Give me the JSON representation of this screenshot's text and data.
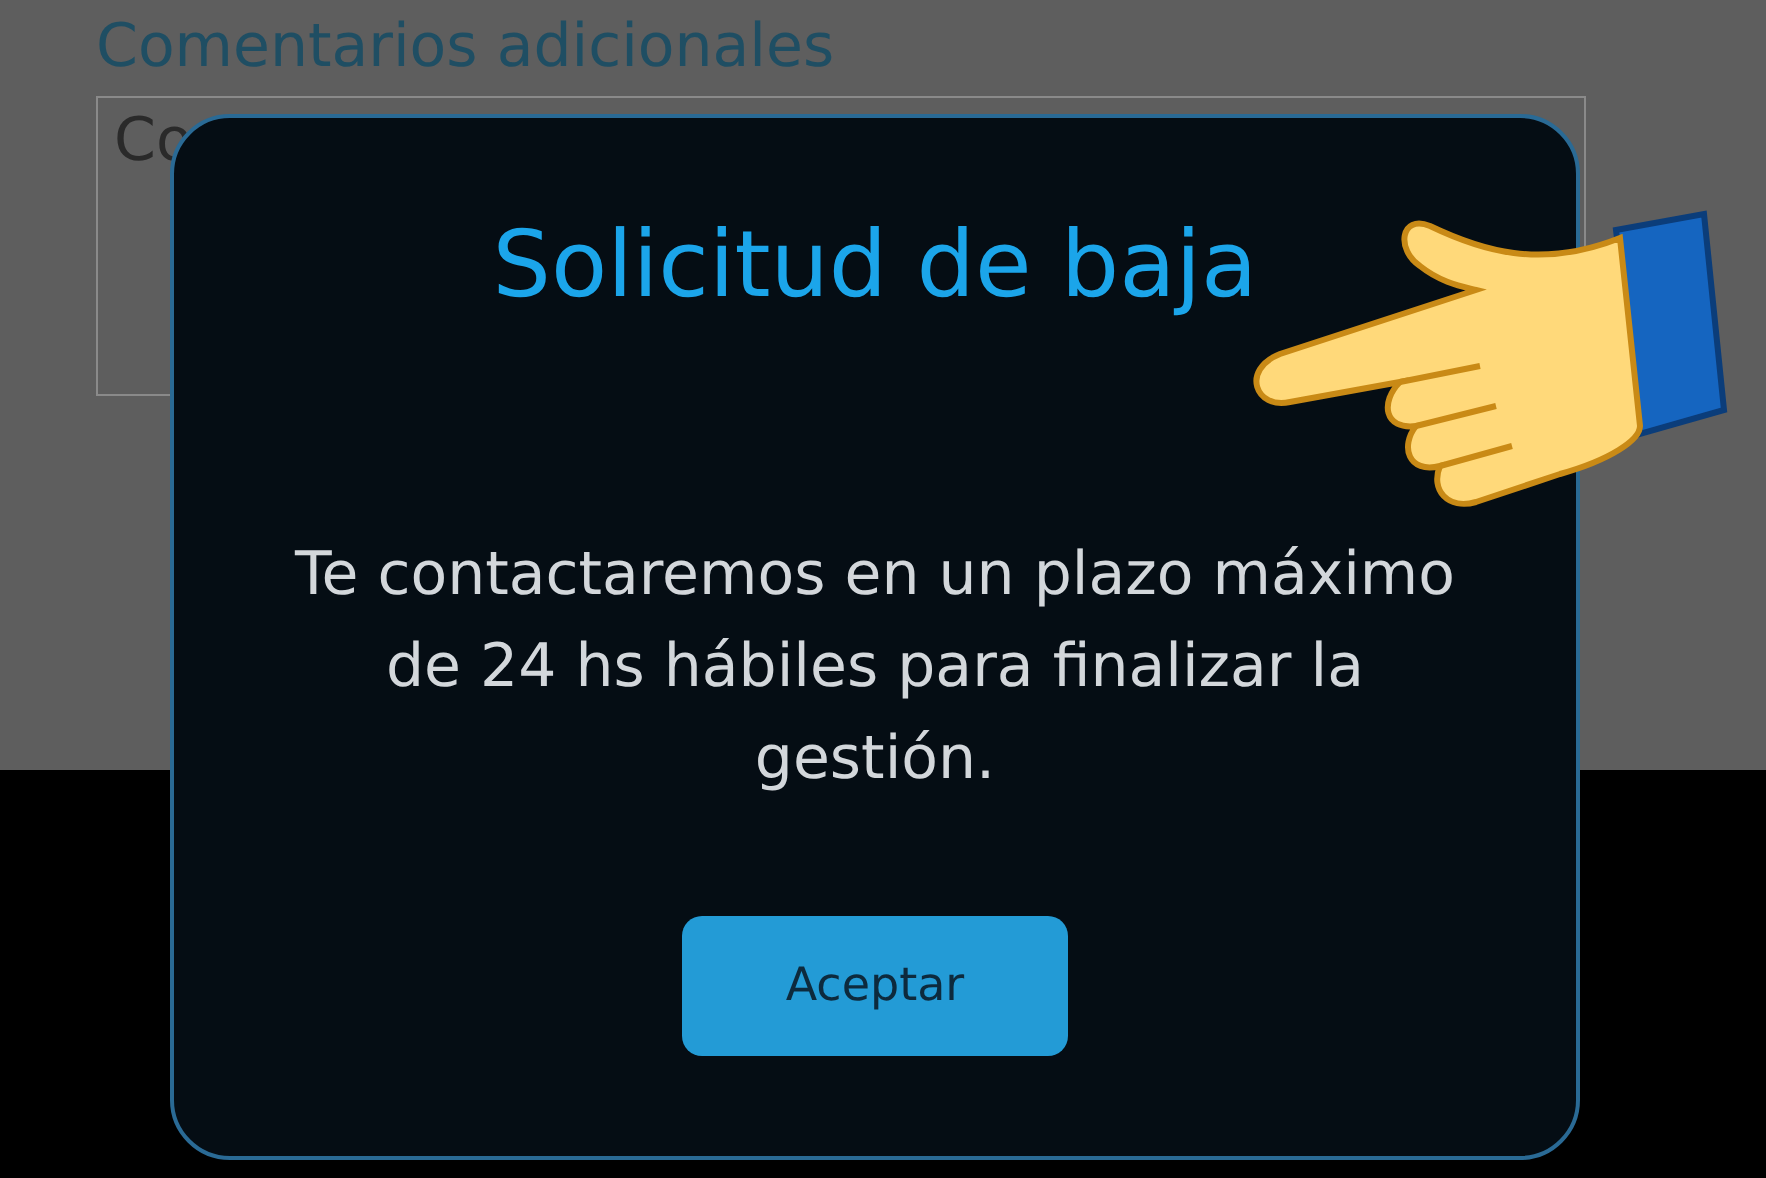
{
  "form": {
    "comments_label": "Comentarios adicionales",
    "comments_field": {
      "placeholder": "Co"
    }
  },
  "dialog": {
    "title": "Solicitud de baja",
    "message": "Te contactaremos en un plazo máximo de 24 hs hábiles para finalizar la gestión.",
    "buttons": [
      {
        "label": "Aceptar",
        "kind": "primary"
      }
    ]
  }
}
